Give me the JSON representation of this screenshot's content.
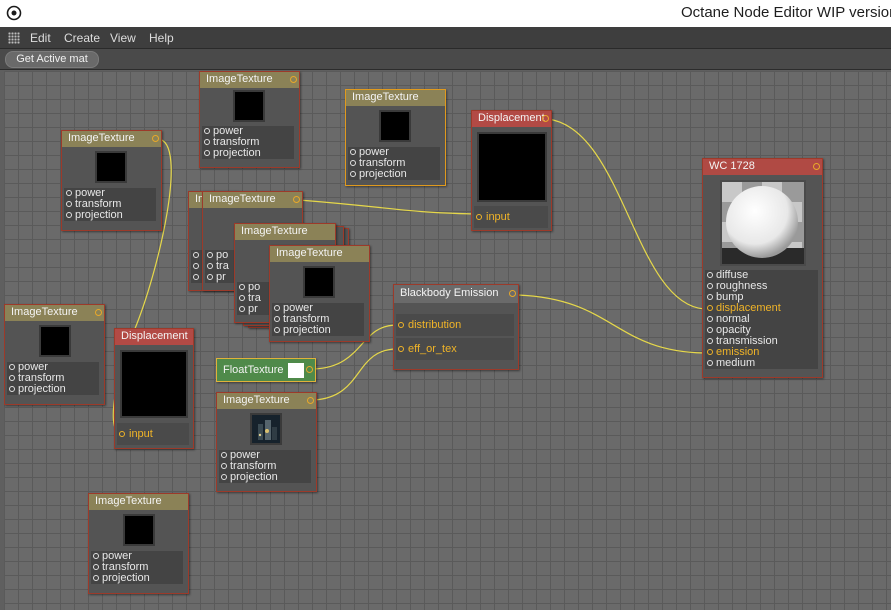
{
  "window": {
    "title": "Octane Node Editor WIP version"
  },
  "menu": [
    "Edit",
    "Create",
    "View",
    "Help"
  ],
  "toolbar": {
    "get_active_mat": "Get Active mat"
  },
  "labels": {
    "image_texture": "ImageTexture",
    "displacement": "Displacement",
    "blackbody": "Blackbody Emission",
    "float_texture": "FloatTexture",
    "material": "WC 1728"
  },
  "tex_ports": [
    "power",
    "transform",
    "projection"
  ],
  "disp_port": "input",
  "blackbody_ports": [
    "distribution",
    "eff_or_tex"
  ],
  "material_ports": [
    "diffuse",
    "roughness",
    "bump",
    "displacement",
    "normal",
    "opacity",
    "transmission",
    "emission",
    "medium"
  ],
  "partial_labels": {
    "stack_head_clip": "Im",
    "row1": "po",
    "row2": "tra",
    "row3": "pr"
  },
  "colors": {
    "wire": "#e6d84a",
    "active_port": "#f0b428",
    "selected_border": "#e09a1e",
    "node_border": "#9c3a2a"
  }
}
